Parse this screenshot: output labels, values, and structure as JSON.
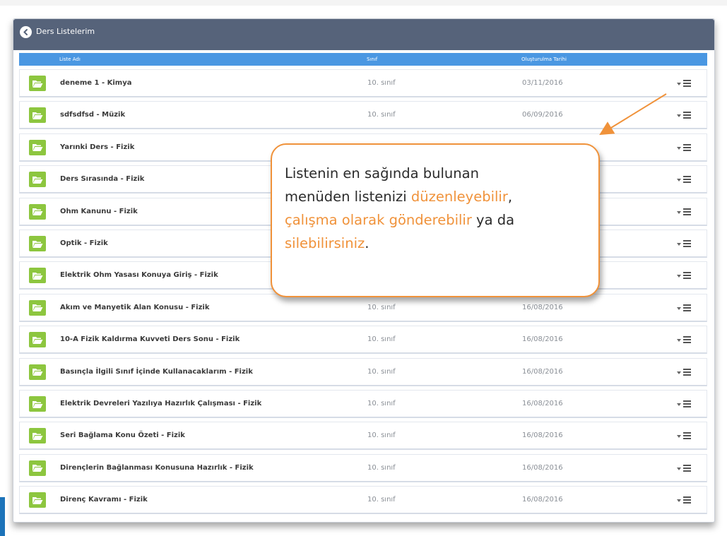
{
  "window": {
    "title": "Ders Listelerim"
  },
  "table": {
    "headers": {
      "name": "Liste Adı",
      "class": "Sınıf",
      "date": "Oluşturulma Tarihi"
    },
    "rows": [
      {
        "name": "deneme 1 - Kimya",
        "class": "10. sınıf",
        "date": "03/11/2016"
      },
      {
        "name": "sdfsdfsd - Müzik",
        "class": "10. sınıf",
        "date": "06/09/2016"
      },
      {
        "name": "Yarınki Ders - Fizik",
        "class": "",
        "date": ""
      },
      {
        "name": "Ders Sırasında - Fizik",
        "class": "",
        "date": ""
      },
      {
        "name": "Ohm Kanunu - Fizik",
        "class": "",
        "date": ""
      },
      {
        "name": "Optik - Fizik",
        "class": "",
        "date": ""
      },
      {
        "name": "Elektrik Ohm Yasası Konuya Giriş - Fizik",
        "class": "",
        "date": ""
      },
      {
        "name": "Akım ve Manyetik Alan Konusu - Fizik",
        "class": "10. sınıf",
        "date": "16/08/2016"
      },
      {
        "name": "10-A Fizik Kaldırma Kuvveti Ders Sonu - Fizik",
        "class": "10. sınıf",
        "date": "16/08/2016"
      },
      {
        "name": "Basınçla İlgili Sınıf İçinde Kullanacaklarım - Fizik",
        "class": "10. sınıf",
        "date": "16/08/2016"
      },
      {
        "name": "Elektrik Devreleri Yazılıya Hazırlık Çalışması - Fizik",
        "class": "10. sınıf",
        "date": "16/08/2016"
      },
      {
        "name": "Seri Bağlama Konu Özeti - Fizik",
        "class": "10. sınıf",
        "date": "16/08/2016"
      },
      {
        "name": "Dirençlerin Bağlanması Konusuna Hazırlık - Fizik",
        "class": "10. sınıf",
        "date": "16/08/2016"
      },
      {
        "name": "Direnç Kavramı - Fizik",
        "class": "10. sınıf",
        "date": "16/08/2016"
      }
    ]
  },
  "callout": {
    "line1": "Listenin en sağında bulunan",
    "line2_a": "menüden listenizi ",
    "line2_hl": "düzenleyebilir",
    "line2_b": ",",
    "line3_hl": "çalışma olarak gönderebilir",
    "line3_b": " ya da",
    "line4_hl": "silebilirsiniz",
    "line4_b": "."
  },
  "colors": {
    "titlebar": "#56637a",
    "header": "#4a97e2",
    "folder": "#8dc63f",
    "accent": "#f0923a"
  },
  "icons": {
    "back": "back-arrow-circle-icon",
    "folder": "folder-open-icon",
    "menu": "hamburger-menu-icon"
  }
}
